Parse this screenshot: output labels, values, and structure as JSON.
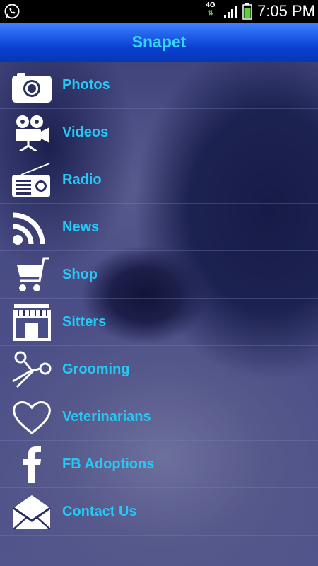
{
  "status_bar": {
    "network": "4G",
    "time": "7:05 PM"
  },
  "header": {
    "title": "Snapet"
  },
  "menu": {
    "items": [
      {
        "label": "Photos",
        "icon": "camera-icon"
      },
      {
        "label": "Videos",
        "icon": "video-camera-icon"
      },
      {
        "label": "Radio",
        "icon": "radio-icon"
      },
      {
        "label": "News",
        "icon": "rss-icon"
      },
      {
        "label": "Shop",
        "icon": "shopping-cart-icon"
      },
      {
        "label": "Sitters",
        "icon": "storefront-icon"
      },
      {
        "label": "Grooming",
        "icon": "scissors-icon"
      },
      {
        "label": "Veterinarians",
        "icon": "heart-icon"
      },
      {
        "label": "FB Adoptions",
        "icon": "facebook-icon"
      },
      {
        "label": "Contact Us",
        "icon": "envelope-icon"
      }
    ]
  },
  "colors": {
    "accent": "#27c8f5",
    "title_text": "#35d4ff",
    "header_blue": "#1f5ee8"
  }
}
